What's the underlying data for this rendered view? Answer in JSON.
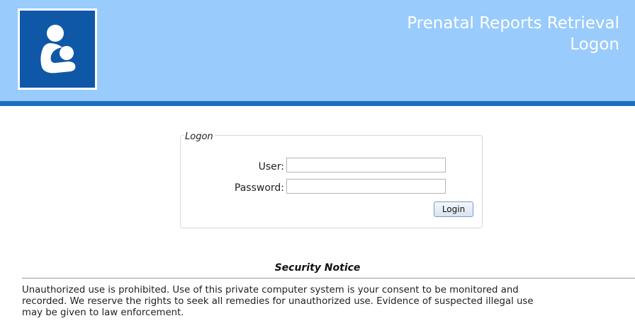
{
  "header": {
    "title_line1": "Prenatal Reports Retrieval",
    "title_line2": "Logon",
    "logo_icon": "mother-breastfeeding-icon",
    "background_color": "#99cbfd",
    "accent_color": "#1a6fc0"
  },
  "logon": {
    "legend": "Logon",
    "user_label": "User:",
    "user_value": "",
    "password_label": "Password:",
    "password_value": "",
    "login_button": "Login"
  },
  "notice": {
    "title": "Security Notice",
    "line1": "Unauthorized use is prohibited. Use of this private computer system is your consent to be monitored and",
    "line2": "recorded. We reserve the rights to seek all remedies for unauthorized use. Evidence of suspected illegal use",
    "line3": "may be given to law enforcement."
  }
}
